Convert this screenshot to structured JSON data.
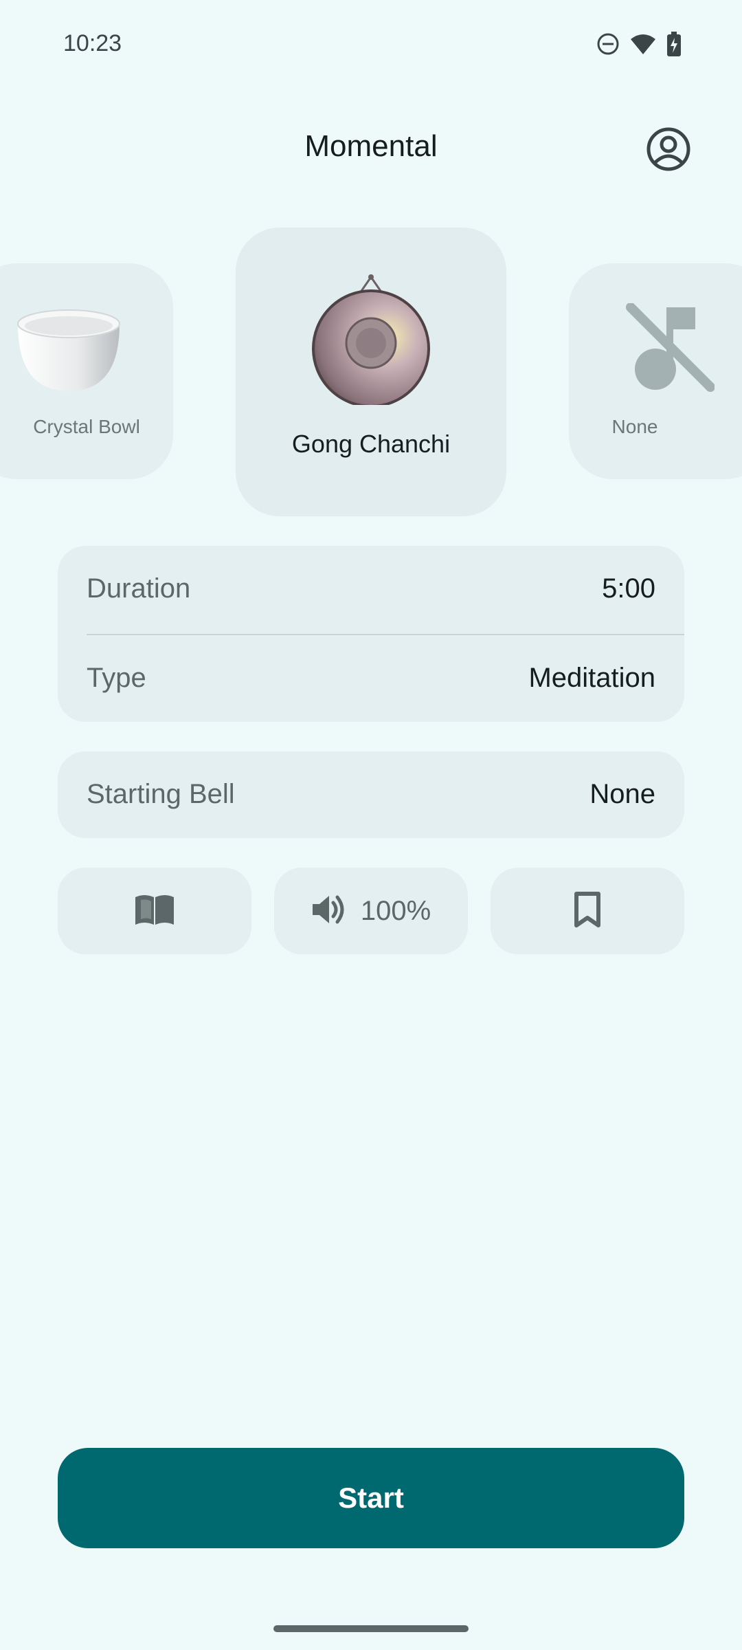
{
  "status_bar": {
    "time": "10:23",
    "icons": [
      "do-not-disturb-icon",
      "wifi-icon",
      "battery-charging-icon"
    ]
  },
  "header": {
    "title": "Momental",
    "profile_icon": "account-circle-icon"
  },
  "sounds": {
    "items": [
      {
        "label": "Crystal Bowl",
        "icon": "crystal-bowl-image"
      },
      {
        "label": "Gong Chanchi",
        "icon": "gong-image",
        "selected": true
      },
      {
        "label": "None",
        "icon": "music-off-icon"
      }
    ]
  },
  "settings": {
    "duration_label": "Duration",
    "duration_value": "5:00",
    "type_label": "Type",
    "type_value": "Meditation",
    "bell_label": "Starting Bell",
    "bell_value": "None"
  },
  "actions": {
    "guide_icon": "book-open-icon",
    "volume_icon": "volume-icon",
    "volume_value": "100%",
    "bookmark_icon": "bookmark-icon"
  },
  "start": {
    "label": "Start"
  },
  "colors": {
    "background": "#eef9fa",
    "card": "#e3eff0",
    "accent": "#006970",
    "icon": "#5c6768"
  }
}
